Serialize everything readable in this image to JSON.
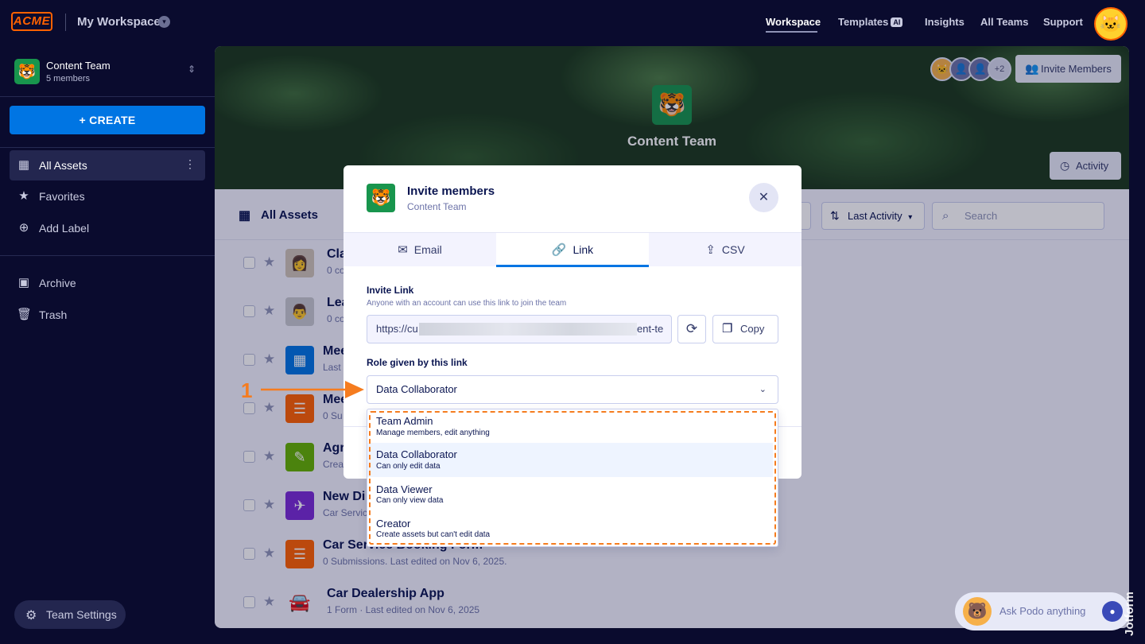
{
  "topbar": {
    "logo": "ACME",
    "workspace_title": "My Workspace",
    "nav": [
      {
        "label": "Workspace"
      },
      {
        "label": "Templates",
        "badge": "AI"
      },
      {
        "label": "Insights"
      },
      {
        "label": "All Teams"
      },
      {
        "label": "Support"
      }
    ]
  },
  "sidebar": {
    "team_name": "Content Team",
    "team_members": "5 members",
    "create_label": "+ CREATE",
    "items": [
      {
        "label": "All Assets"
      },
      {
        "label": "Favorites"
      },
      {
        "label": "Add Label"
      },
      {
        "label": "Archive"
      },
      {
        "label": "Trash"
      }
    ],
    "team_settings_label": "Team Settings"
  },
  "banner": {
    "title": "Content Team",
    "extra_members": "+2",
    "invite_label": "Invite Members",
    "activity_label": "Activity"
  },
  "toolbar": {
    "title": "All Assets",
    "sort_label": "Last Activity",
    "search_placeholder": "Search"
  },
  "assets": [
    {
      "title": "Cla",
      "sub": "0 co"
    },
    {
      "title": "Lea",
      "sub": "0 co"
    },
    {
      "title": "Mee",
      "sub": "Last"
    },
    {
      "title": "Mee",
      "sub": "0 Su"
    },
    {
      "title": "Agr",
      "sub": "Crea"
    },
    {
      "title": "New Di",
      "sub": "Car Servic"
    },
    {
      "title": "Car Service Booking Form",
      "sub": "0 Submissions.  Last edited on Nov 6, 2025."
    },
    {
      "title": "Car Dealership App",
      "sub": "1 Form · Last edited on Nov 6, 2025"
    }
  ],
  "modal": {
    "title": "Invite members",
    "subtitle": "Content Team",
    "tabs": [
      {
        "label": "Email"
      },
      {
        "label": "Link"
      },
      {
        "label": "CSV"
      }
    ],
    "active_tab": "Link",
    "invite_link_label": "Invite Link",
    "invite_link_help": "Anyone with an account can use this link to join the team",
    "link_prefix": "https://cu",
    "link_suffix": "ent-te",
    "copy_label": "Copy",
    "role_label": "Role given by this link",
    "role_value": "Data Collaborator"
  },
  "role_options": [
    {
      "name": "Team Admin",
      "desc": "Manage members, edit anything"
    },
    {
      "name": "Data Collaborator",
      "desc": "Can only edit data"
    },
    {
      "name": "Data Viewer",
      "desc": "Can only view data"
    },
    {
      "name": "Creator",
      "desc": "Create assets but can't edit data"
    }
  ],
  "annotation": {
    "step": "1",
    "color": "#f57c1f"
  },
  "podo": {
    "label": "Ask Podo anything"
  },
  "watermark": "Jotform",
  "colors": {
    "accent": "#0075e3",
    "sidebar_bg": "#0a0b2e",
    "team_green": "#18954d",
    "logo_orange": "#ff6100"
  }
}
